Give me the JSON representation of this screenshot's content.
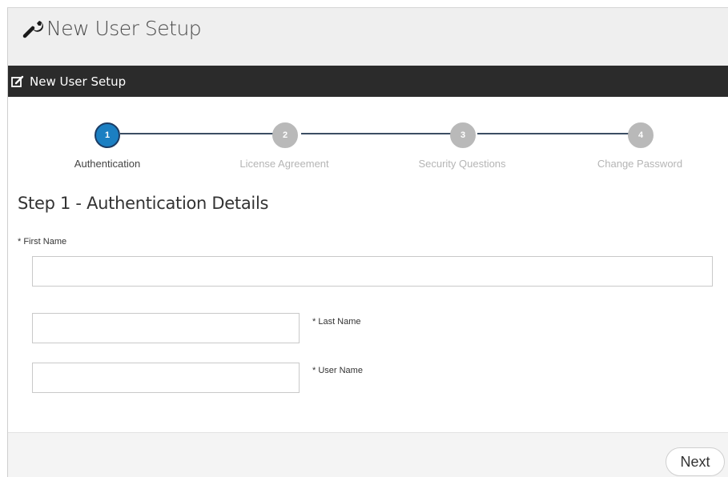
{
  "header": {
    "title": "New User Setup",
    "icon": "wrench-icon"
  },
  "panel": {
    "title": "New User Setup",
    "icon": "edit-icon"
  },
  "wizard": {
    "active_color": "#1b7fc2",
    "inactive_color": "#b9b9b9",
    "steps": [
      {
        "number": "1",
        "label": "Authentication",
        "active": true
      },
      {
        "number": "2",
        "label": "License Agreement",
        "active": false
      },
      {
        "number": "3",
        "label": "Security Questions",
        "active": false
      },
      {
        "number": "4",
        "label": "Change Password",
        "active": false
      }
    ]
  },
  "form": {
    "heading": "Step 1 - Authentication Details",
    "first_name": {
      "label": "* First Name",
      "value": ""
    },
    "last_name": {
      "label": "* Last Name",
      "value": ""
    },
    "user_name": {
      "label": "* User Name",
      "value": ""
    }
  },
  "footer": {
    "next_label": "Next"
  }
}
